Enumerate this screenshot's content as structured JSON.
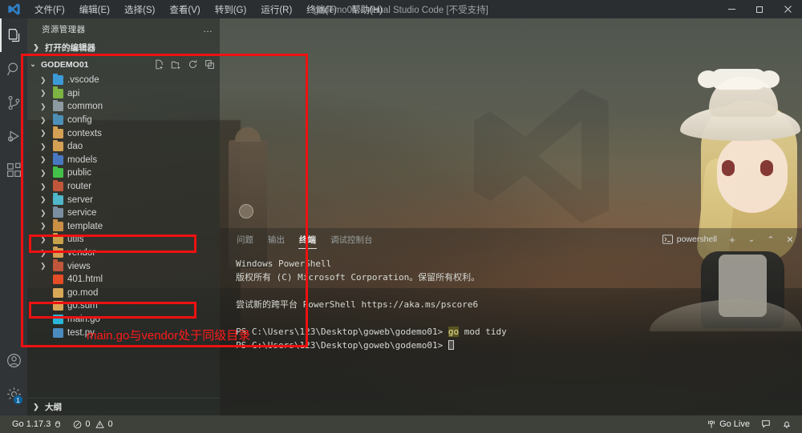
{
  "window": {
    "title": "godemo01 - Visual Studio Code [不受支持]",
    "logo_icon": "vscode-logo-icon",
    "controls": [
      {
        "name": "minimize-button",
        "glyph": "—"
      },
      {
        "name": "maximize-button",
        "glyph": "❐"
      },
      {
        "name": "close-button",
        "glyph": "✕"
      }
    ]
  },
  "menubar": {
    "items": [
      {
        "label": "文件(F)"
      },
      {
        "label": "编辑(E)"
      },
      {
        "label": "选择(S)"
      },
      {
        "label": "查看(V)"
      },
      {
        "label": "转到(G)"
      },
      {
        "label": "运行(R)"
      },
      {
        "label": "终端(T)"
      },
      {
        "label": "帮助(H)"
      }
    ]
  },
  "activitybar": {
    "items": [
      {
        "name": "explorer",
        "icon": "files-icon",
        "active": true
      },
      {
        "name": "search",
        "icon": "search-icon",
        "active": false
      },
      {
        "name": "source-control",
        "icon": "source-control-icon",
        "active": false
      },
      {
        "name": "run-debug",
        "icon": "run-debug-icon",
        "active": false
      },
      {
        "name": "extensions",
        "icon": "extensions-icon",
        "active": false
      }
    ],
    "bottom": [
      {
        "name": "accounts",
        "icon": "account-icon",
        "badge": ""
      },
      {
        "name": "manage",
        "icon": "gear-icon",
        "badge": "1"
      }
    ]
  },
  "sidebar": {
    "title": "资源管理器",
    "more_actions": "…",
    "open_editors_label": "打开的编辑器",
    "project_label": "GODEMO01",
    "outline_label": "大纲",
    "toolbar": [
      {
        "name": "new-file-icon",
        "title": "新建文件"
      },
      {
        "name": "new-folder-icon",
        "title": "新建文件夹"
      },
      {
        "name": "refresh-icon",
        "title": "刷新"
      },
      {
        "name": "collapse-all-icon",
        "title": "全部折叠"
      }
    ],
    "tree": [
      {
        "label": ".vscode",
        "type": "folder",
        "color": "#3c9ad6"
      },
      {
        "label": "api",
        "type": "folder",
        "color": "#7cb342"
      },
      {
        "label": "common",
        "type": "folder",
        "color": "#8d9aa0"
      },
      {
        "label": "config",
        "type": "folder",
        "color": "#4e8fb8"
      },
      {
        "label": "contexts",
        "type": "folder",
        "color": "#d3a054"
      },
      {
        "label": "dao",
        "type": "folder",
        "color": "#d3a054"
      },
      {
        "label": "models",
        "type": "folder",
        "color": "#4878c0"
      },
      {
        "label": "public",
        "type": "folder",
        "color": "#43c04a"
      },
      {
        "label": "router",
        "type": "folder",
        "color": "#c0563a"
      },
      {
        "label": "server",
        "type": "folder",
        "color": "#4fb7c9"
      },
      {
        "label": "service",
        "type": "folder",
        "color": "#7b8ea0"
      },
      {
        "label": "template",
        "type": "folder",
        "color": "#c98f44"
      },
      {
        "label": "utils",
        "type": "folder",
        "color": "#c7a24a"
      },
      {
        "label": "vendor",
        "type": "folder",
        "color": "#d3a054"
      },
      {
        "label": "views",
        "type": "folder",
        "color": "#c0563a"
      },
      {
        "label": "401.html",
        "type": "file",
        "color": "#e44d26"
      },
      {
        "label": "go.mod",
        "type": "file",
        "color": "#d8a657"
      },
      {
        "label": "go.sum",
        "type": "file",
        "color": "#d8a657"
      },
      {
        "label": "main.go",
        "type": "file",
        "color": "#29b6d8"
      },
      {
        "label": "test.py",
        "type": "file",
        "color": "#4b8bbe"
      }
    ]
  },
  "panel": {
    "tabs": [
      {
        "label": "问题",
        "active": false
      },
      {
        "label": "输出",
        "active": false
      },
      {
        "label": "终端",
        "active": true
      },
      {
        "label": "调试控制台",
        "active": false
      }
    ],
    "terminal_selector": "powershell",
    "terminal_icon": "terminal-icon",
    "actions": [
      {
        "name": "new-terminal-button",
        "glyph": "+"
      },
      {
        "name": "terminal-dropdown-button",
        "glyph": "⌄"
      },
      {
        "name": "maximize-panel-button",
        "glyph": "⌃"
      },
      {
        "name": "close-panel-button",
        "glyph": "✕"
      }
    ],
    "terminal_lines": [
      {
        "text": "Windows PowerShell"
      },
      {
        "text": "版权所有 (C) Microsoft Corporation。保留所有权利。"
      },
      {
        "text": ""
      },
      {
        "text": "尝试新的跨平台 PowerShell https://aka.ms/pscore6"
      },
      {
        "text": ""
      },
      {
        "prompt": "PS C:\\Users\\123\\Desktop\\goweb\\godemo01> ",
        "command": "go",
        "rest": " mod tidy"
      },
      {
        "prompt": "PS C:\\Users\\123\\Desktop\\goweb\\godemo01> ",
        "cursor": true
      }
    ]
  },
  "statusbar": {
    "left": [
      {
        "name": "go-version",
        "label": "Go 1.17.3",
        "icon": "go-gopher-icon"
      },
      {
        "name": "problems",
        "errors": "0",
        "warnings": "0"
      }
    ],
    "right": [
      {
        "name": "go-live",
        "label": "Go Live",
        "icon": "broadcast-icon"
      },
      {
        "name": "feedback",
        "label": "",
        "icon": "feedback-icon"
      },
      {
        "name": "notifications",
        "label": "",
        "icon": "bell-icon"
      }
    ]
  },
  "annotations": {
    "color": "#ee1111",
    "note": "main.go与vendor处于同级目录",
    "boxes": [
      {
        "name": "project-tree-highlight"
      },
      {
        "name": "vendor-row-highlight"
      },
      {
        "name": "main-go-row-highlight"
      }
    ]
  }
}
